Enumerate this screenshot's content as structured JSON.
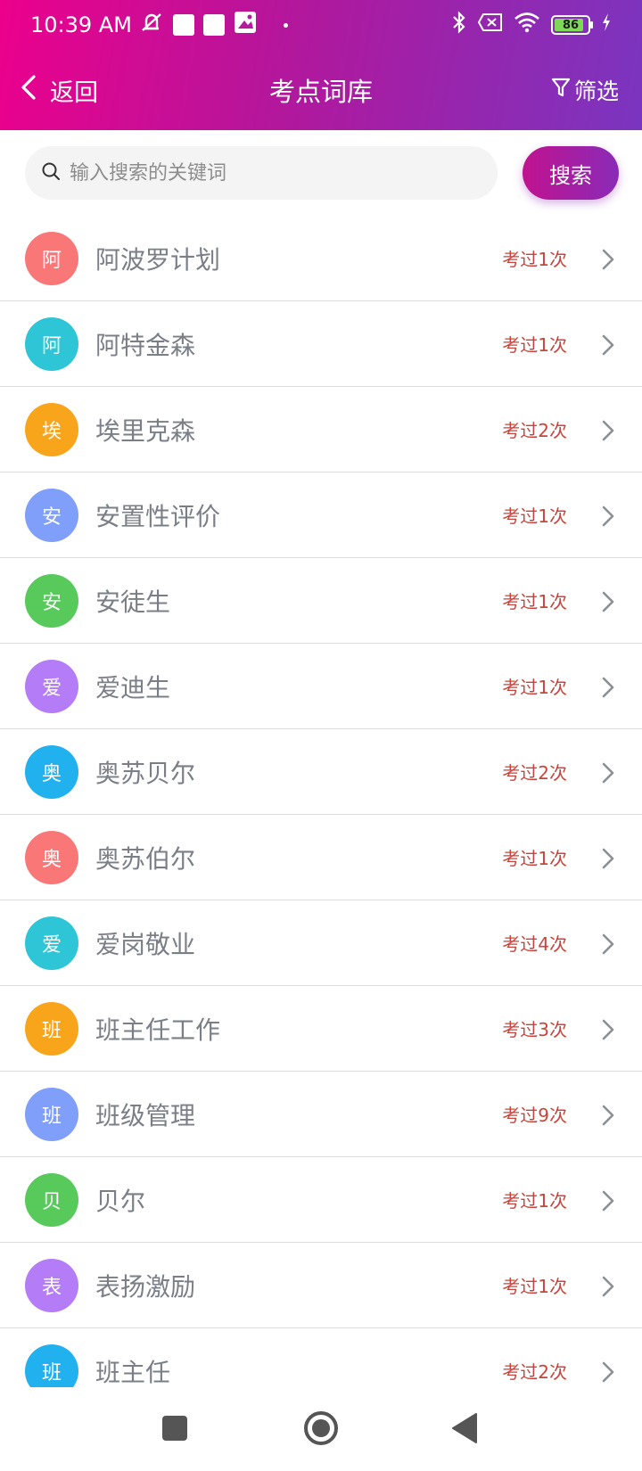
{
  "status_bar": {
    "time": "10:39 AM",
    "battery_level": "86",
    "icons": [
      "mute-icon",
      "notification-icon",
      "notification-icon",
      "gallery-icon",
      "bluetooth-icon",
      "sim-off-icon",
      "wifi-icon",
      "battery-icon",
      "charging-icon"
    ]
  },
  "header": {
    "back_label": "返回",
    "title": "考点词库",
    "filter_label": "筛选"
  },
  "search": {
    "placeholder": "输入搜索的关键词",
    "button_label": "搜索"
  },
  "colors": {
    "accent_start": "#ec008c",
    "accent_end": "#7a35c0",
    "count_text": "#c9433c",
    "term_text": "#7a7f87"
  },
  "terms": [
    {
      "initial": "阿",
      "term": "阿波罗计划",
      "count": "考过1次",
      "color": "#f97877"
    },
    {
      "initial": "阿",
      "term": "阿特金森",
      "count": "考过1次",
      "color": "#2ec6d6"
    },
    {
      "initial": "埃",
      "term": "埃里克森",
      "count": "考过2次",
      "color": "#f9a51c"
    },
    {
      "initial": "安",
      "term": "安置性评价",
      "count": "考过1次",
      "color": "#7f9ffa"
    },
    {
      "initial": "安",
      "term": "安徒生",
      "count": "考过1次",
      "color": "#58ca5b"
    },
    {
      "initial": "爱",
      "term": "爱迪生",
      "count": "考过1次",
      "color": "#b47cf6"
    },
    {
      "initial": "奥",
      "term": "奥苏贝尔",
      "count": "考过2次",
      "color": "#22b1ef"
    },
    {
      "initial": "奥",
      "term": "奥苏伯尔",
      "count": "考过1次",
      "color": "#f97877"
    },
    {
      "initial": "爱",
      "term": "爱岗敬业",
      "count": "考过4次",
      "color": "#2ec6d6"
    },
    {
      "initial": "班",
      "term": "班主任工作",
      "count": "考过3次",
      "color": "#f9a51c"
    },
    {
      "initial": "班",
      "term": "班级管理",
      "count": "考过9次",
      "color": "#7f9ffa"
    },
    {
      "initial": "贝",
      "term": "贝尔",
      "count": "考过1次",
      "color": "#58ca5b"
    },
    {
      "initial": "表",
      "term": "表扬激励",
      "count": "考过1次",
      "color": "#b47cf6"
    },
    {
      "initial": "班",
      "term": "班主任",
      "count": "考过2次",
      "color": "#22b1ef"
    }
  ]
}
